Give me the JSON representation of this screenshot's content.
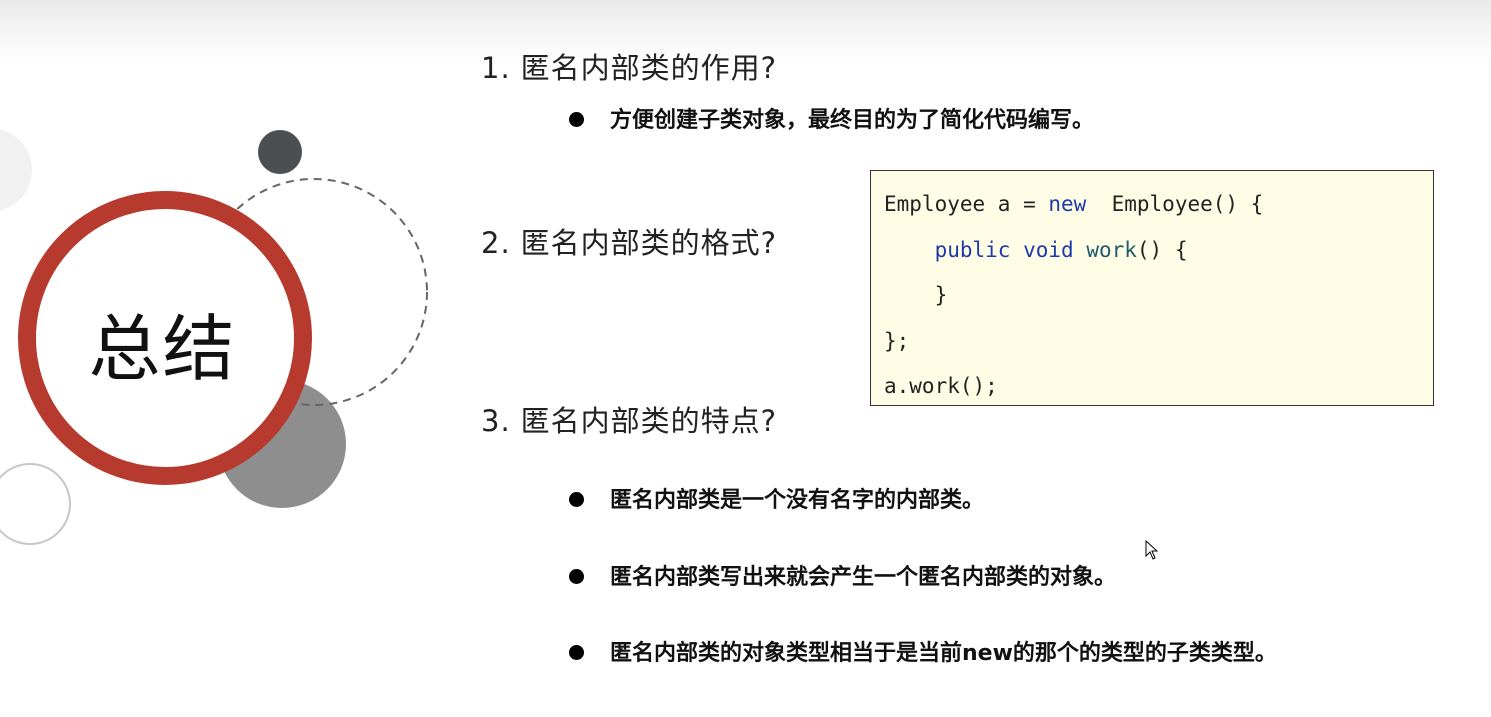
{
  "slide": {
    "title": "总结",
    "q1": {
      "num": "1.",
      "text": "匿名内部类的作用?"
    },
    "q1_bullets": [
      "方便创建子类对象，最终目的为了简化代码编写。"
    ],
    "q2": {
      "num": "2.",
      "text": "匿名内部类的格式?"
    },
    "q3": {
      "num": "3.",
      "text": "匿名内部类的特点?"
    },
    "q3_bullets": [
      "匿名内部类是一个没有名字的内部类。",
      "匿名内部类写出来就会产生一个匿名内部类的对象。",
      "匿名内部类的对象类型相当于是当前new的那个的类型的子类类型。"
    ]
  },
  "code": {
    "line1": {
      "a": "Employee a = ",
      "b": "new",
      "c": "  Employee() {"
    },
    "line2": {
      "indent": "    ",
      "a": "public",
      "sp1": " ",
      "b": "void",
      "sp2": " ",
      "c": "work",
      "d": "() {"
    },
    "line3": "    }",
    "line4": "};",
    "line5": "a.work();"
  },
  "colors": {
    "ring": "#b63a2e",
    "dark_circle": "#4b4f51",
    "gray_circle": "#8e8e8e",
    "code_bg": "#fffde5",
    "keyword": "#1c3aa9"
  }
}
